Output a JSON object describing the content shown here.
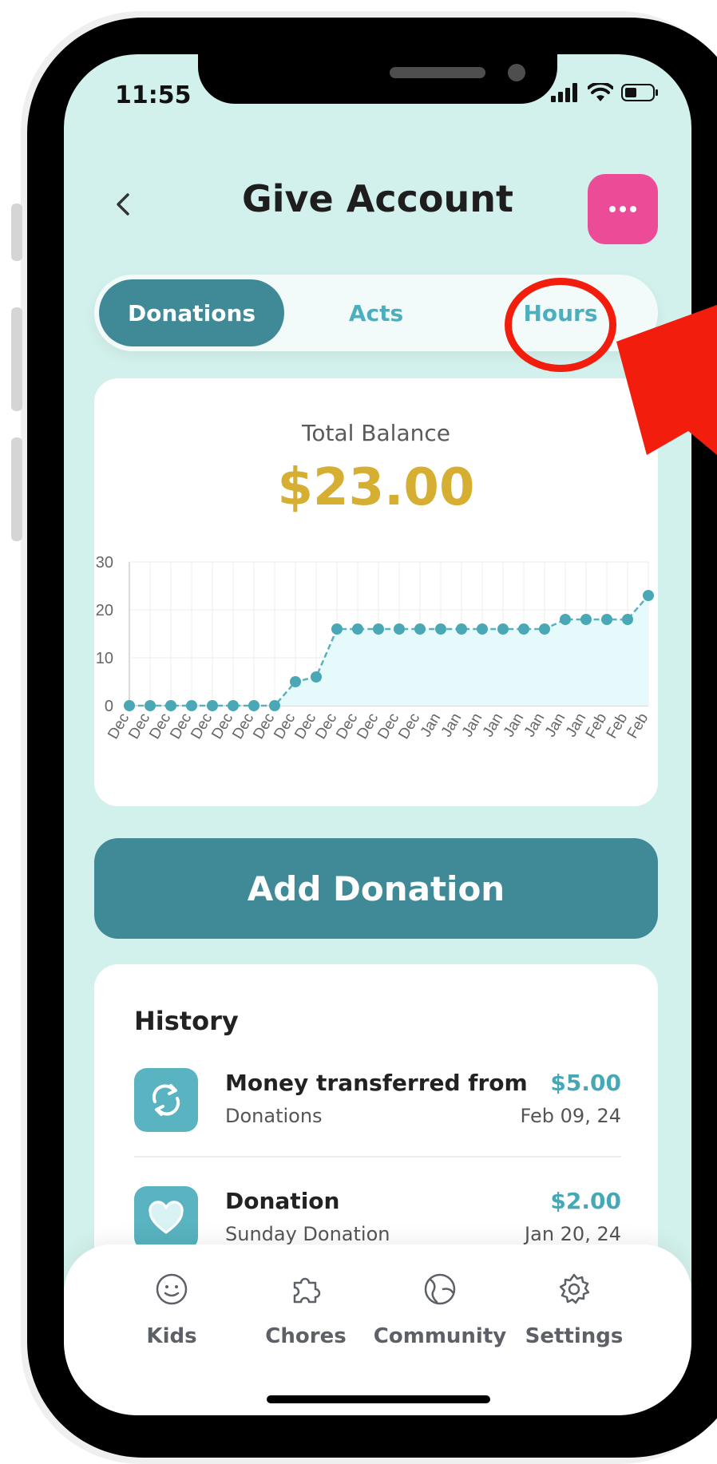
{
  "status_bar": {
    "time": "11:55"
  },
  "header": {
    "title": "Give Account"
  },
  "tabs": [
    {
      "label": "Donations",
      "active": true
    },
    {
      "label": "Acts",
      "active": false
    },
    {
      "label": "Hours",
      "active": false
    }
  ],
  "balance": {
    "label": "Total Balance",
    "value": "$23.00"
  },
  "chart_data": {
    "type": "area",
    "x": [
      "Dec",
      "Dec",
      "Dec",
      "Dec",
      "Dec",
      "Dec",
      "Dec",
      "Dec",
      "Dec",
      "Dec",
      "Dec",
      "Dec",
      "Dec",
      "Dec",
      "Dec",
      "Jan",
      "Jan",
      "Jan",
      "Jan",
      "Jan",
      "Jan",
      "Jan",
      "Jan",
      "Feb",
      "Feb",
      "Feb"
    ],
    "values": [
      0,
      0,
      0,
      0,
      0,
      0,
      0,
      0,
      5,
      6,
      16,
      16,
      16,
      16,
      16,
      16,
      16,
      16,
      16,
      16,
      16,
      18,
      18,
      18,
      18,
      23
    ],
    "ylim": [
      0,
      30
    ],
    "yticks": [
      0,
      10,
      20,
      30
    ],
    "grid": true,
    "colors": {
      "line": "#5ab2bf",
      "fill": "#e6fafb",
      "marker": "#4aa8b6"
    }
  },
  "add_button": {
    "label": "Add Donation"
  },
  "history": {
    "title": "History",
    "items": [
      {
        "title": "Money transferred from",
        "subtitle": "Donations",
        "amount": "$5.00",
        "date": "Feb 09, 24",
        "icon": "transfer-icon"
      },
      {
        "title": "Donation",
        "subtitle": "Sunday Donation",
        "amount": "$2.00",
        "date": "Jan 20, 24",
        "icon": "heart-icon"
      }
    ]
  },
  "nav": [
    {
      "label": "Kids",
      "icon": "smiley-icon"
    },
    {
      "label": "Chores",
      "icon": "puzzle-icon"
    },
    {
      "label": "Community",
      "icon": "globe-icon"
    },
    {
      "label": "Settings",
      "icon": "gear-icon"
    }
  ],
  "colors": {
    "accent": "#3f8a96",
    "background": "#d3f1ec",
    "menu_button": "#ec4c97",
    "balance": "#d5ae32",
    "annotation": "#f21d0c"
  }
}
